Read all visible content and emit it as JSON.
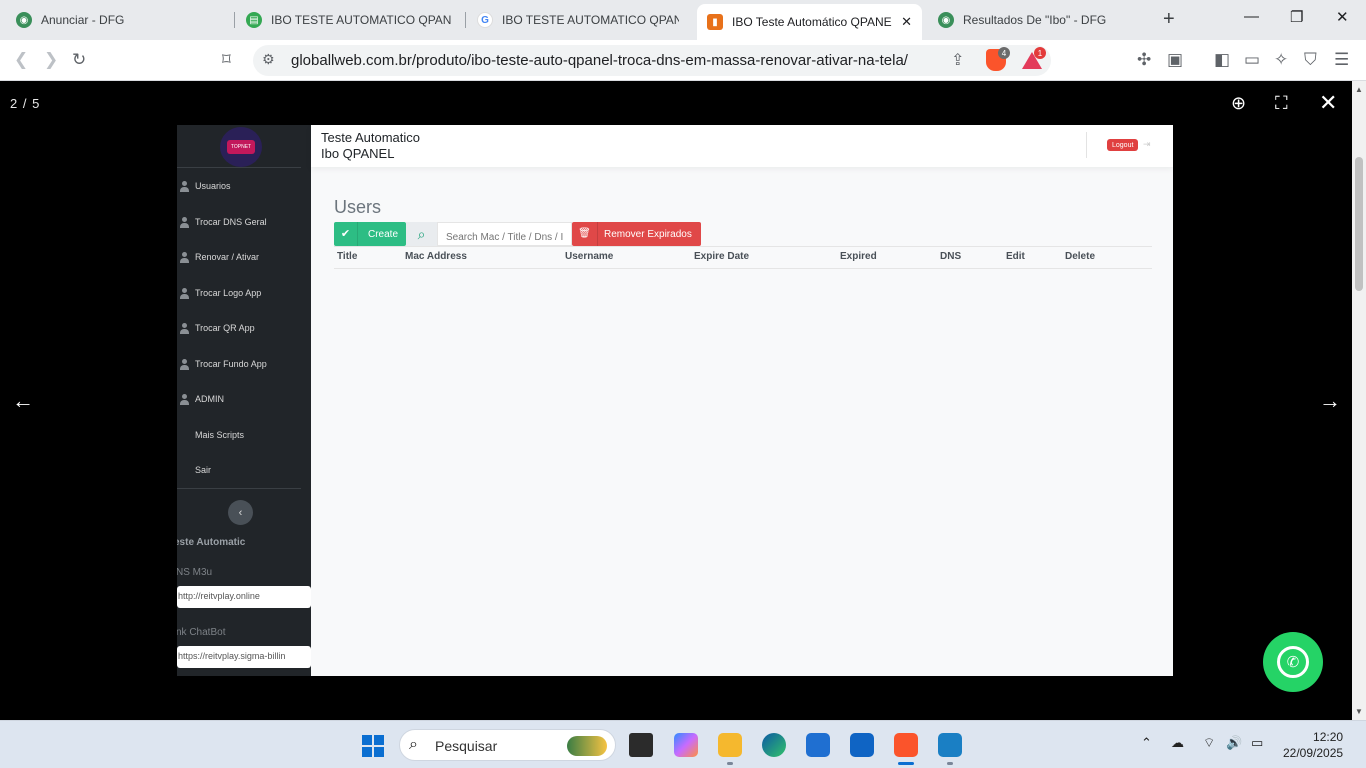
{
  "browser": {
    "tabs": [
      {
        "title": "Anunciar - DFG",
        "fav_color": "#3a8f5a"
      },
      {
        "title": "IBO TESTE AUTOMATICO QPANEL",
        "fav_color": "#34a853"
      },
      {
        "title": "IBO TESTE AUTOMATICO QPANEL",
        "fav_color": "#4285f4"
      },
      {
        "title": "IBO Teste Automático QPANE",
        "fav_color": "#e8711a"
      },
      {
        "title": "Resultados De \"Ibo\" - DFG",
        "fav_color": "#3a8f5a"
      }
    ],
    "active_tab_close": "✕",
    "new_tab": "+",
    "url": "globallweb.com.br/produto/ibo-teste-auto-qpanel-troca-dns-em-massa-renovar-ativar-na-tela/",
    "shield_count": "4",
    "rewards_count": "1"
  },
  "lightbox": {
    "counter": "2 / 5"
  },
  "panel": {
    "logo_text": "TOPNET",
    "header_line1": "Teste Automatico",
    "header_line2": "Ibo QPANEL",
    "logout_label": "Logout",
    "menu": [
      {
        "label": "Usuarios"
      },
      {
        "label": "Trocar DNS Geral"
      },
      {
        "label": "Renovar / Ativar"
      },
      {
        "label": "Trocar Logo App"
      },
      {
        "label": "Trocar QR App"
      },
      {
        "label": "Trocar Fundo App"
      },
      {
        "label": "ADMIN"
      }
    ],
    "submenu": [
      {
        "label": "Mais Scripts"
      },
      {
        "label": "Sair"
      }
    ],
    "collapse_icon": "‹",
    "side_heading": "este Automatic",
    "dns_label": "NS M3u",
    "dns_value": "http://reitvplay.online",
    "chatbot_label": "nk ChatBot",
    "chatbot_value": "https://reitvplay.sigma-billin",
    "page_title": "Users",
    "create_label": "Create",
    "search_placeholder": "Search Mac / Title / Dns / I",
    "remove_label": "Remover Expirados",
    "columns": [
      "Title",
      "Mac Address",
      "Username",
      "Expire Date",
      "Expired",
      "DNS",
      "Edit",
      "Delete"
    ]
  },
  "taskbar": {
    "search_placeholder": "Pesquisar",
    "time": "12:20",
    "date": "22/09/2025"
  },
  "colors": {
    "create_green": "#2dbd84",
    "remove_red": "#e04848",
    "sidebar_dark": "#212529",
    "whatsapp_green": "#25d366"
  }
}
